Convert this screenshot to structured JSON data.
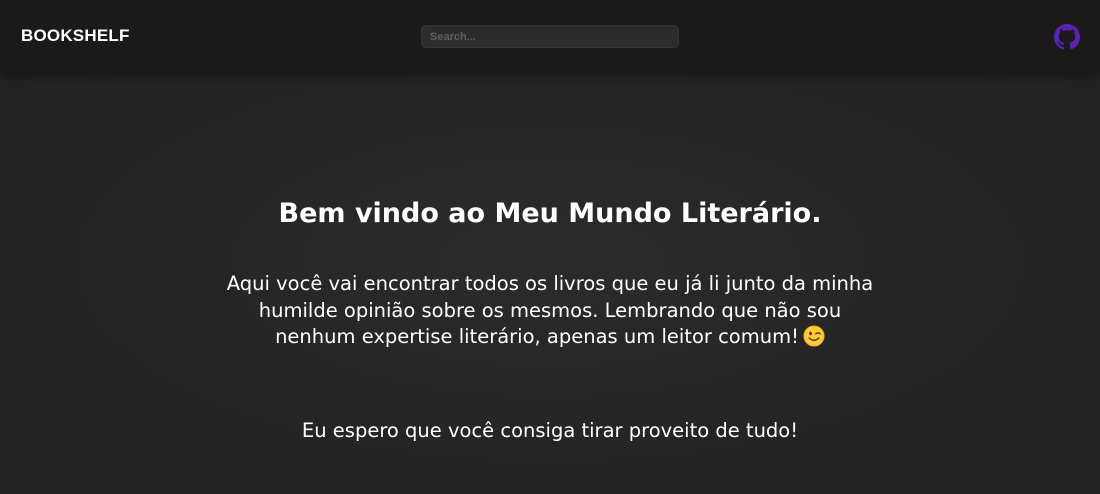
{
  "header": {
    "brand": "BOOKSHELF",
    "search_placeholder": "Search...",
    "github_icon": "github-icon",
    "accent_color": "#5b21b6"
  },
  "main": {
    "title": "Bem vindo ao Meu Mundo Literário.",
    "intro_text": "Aqui você vai encontrar todos os livros que eu já li junto da minha humilde opinião sobre os mesmos. Lembrando que não sou nenhum expertise literário, apenas um leitor comum!",
    "intro_emoji": "winking-face-emoji",
    "closing_text": "Eu espero que você consiga tirar proveito de tudo!"
  }
}
